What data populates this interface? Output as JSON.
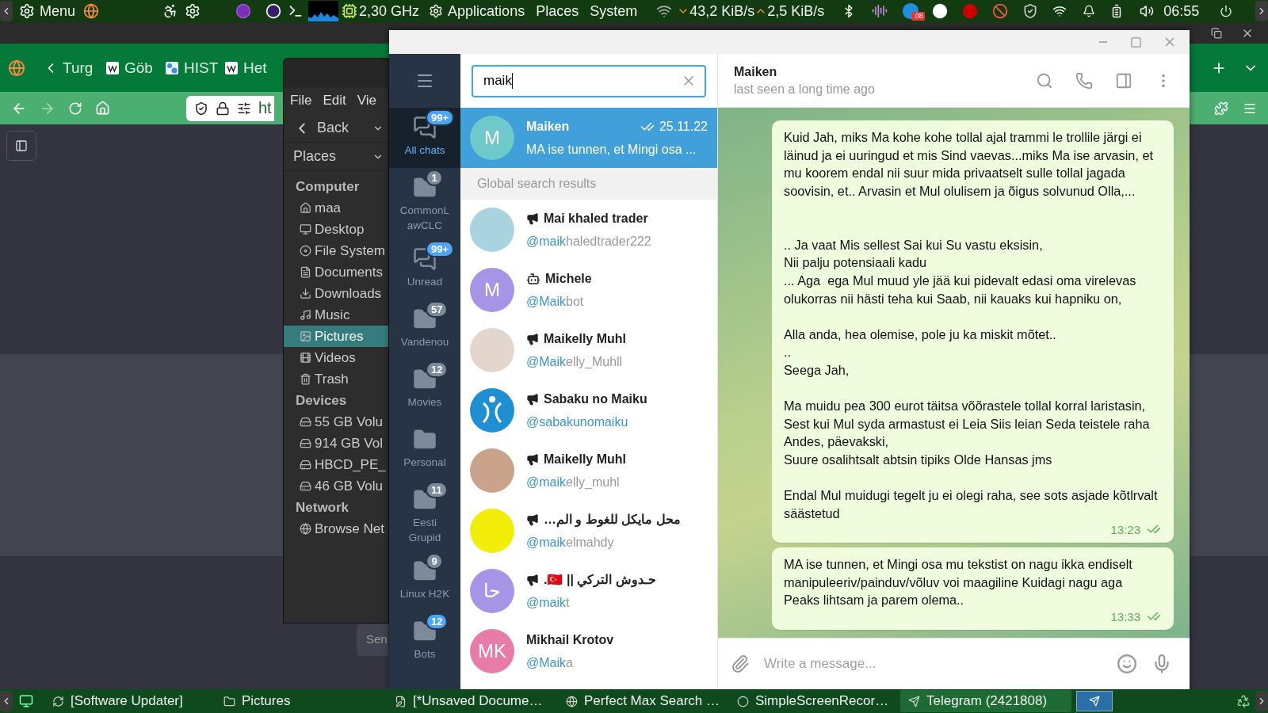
{
  "top_panel": {
    "menu_label": "Menu",
    "cpu_freq": "2,30 GHz",
    "menus": [
      "Applications",
      "Places",
      "System"
    ],
    "net_down": "43,2 KiB/s",
    "net_up": "2,5 KiB/s",
    "tray_badge": ".08",
    "clock": "06:55"
  },
  "browser": {
    "tabs": [
      {
        "label": "Turg",
        "kind": "plain"
      },
      {
        "label": "Göb",
        "kind": "page"
      },
      {
        "label": "HIST",
        "kind": "image"
      },
      {
        "label": "Het",
        "kind": "page"
      }
    ],
    "url": "ht",
    "send_button": "Sen"
  },
  "file_manager": {
    "menus": [
      "File",
      "Edit",
      "Vie"
    ],
    "back": "Back",
    "location": "Places",
    "sections": [
      {
        "title": "Computer",
        "items": [
          {
            "label": "maa",
            "kind": "home",
            "selected": false
          },
          {
            "label": "Desktop",
            "kind": "desktop",
            "selected": false
          },
          {
            "label": "File System",
            "kind": "disk",
            "selected": false
          },
          {
            "label": "Documents",
            "kind": "documents",
            "selected": false
          },
          {
            "label": "Downloads",
            "kind": "downloads",
            "selected": false
          },
          {
            "label": "Music",
            "kind": "music",
            "selected": false
          },
          {
            "label": "Pictures",
            "kind": "pictures",
            "selected": true
          },
          {
            "label": "Videos",
            "kind": "videos",
            "selected": false
          },
          {
            "label": "Trash",
            "kind": "trash",
            "selected": false
          }
        ]
      },
      {
        "title": "Devices",
        "items": [
          {
            "label": "55 GB Volu",
            "kind": "drive",
            "selected": false
          },
          {
            "label": "914 GB Vol",
            "kind": "drive",
            "selected": false
          },
          {
            "label": "HBCD_PE_",
            "kind": "drive",
            "selected": false
          },
          {
            "label": "46 GB Volu",
            "kind": "drive",
            "selected": false
          }
        ]
      },
      {
        "title": "Network",
        "items": [
          {
            "label": "Browse Net",
            "kind": "network",
            "selected": false
          }
        ]
      }
    ]
  },
  "telegram": {
    "folders": [
      {
        "label": "All chats",
        "kind": "chats",
        "badge": "99+",
        "muted": false,
        "selected": true
      },
      {
        "label": "CommonLawCLC",
        "kind": "folder",
        "badge": "1",
        "muted": true,
        "selected": false
      },
      {
        "label": "Unread",
        "kind": "chats",
        "badge": "99+",
        "muted": false,
        "selected": false
      },
      {
        "label": "Vandenou",
        "kind": "folder",
        "badge": "57",
        "muted": true,
        "selected": false
      },
      {
        "label": "Movies",
        "kind": "folder",
        "badge": "12",
        "muted": true,
        "selected": false
      },
      {
        "label": "Personal",
        "kind": "folder",
        "selected": false
      },
      {
        "label": "Eesti Grupid",
        "kind": "folder",
        "badge": "11",
        "muted": true,
        "selected": false
      },
      {
        "label": "Linux H2K",
        "kind": "folder",
        "badge": "9",
        "muted": true,
        "selected": false
      },
      {
        "label": "Bots",
        "kind": "folder",
        "badge": "12",
        "muted": false,
        "selected": false
      }
    ],
    "search": {
      "value": "maik"
    },
    "chats": [
      {
        "name": "Maiken",
        "initials": "M",
        "color": "#6ec9cb",
        "date": "25.11.22",
        "read": true,
        "preview": "MA ise tunnen, et Mingi osa ...",
        "selected": true
      }
    ],
    "section_header": "Global search results",
    "results": [
      {
        "name": "Mai khaled trader",
        "kind": "channel",
        "handle_match": "@maik",
        "handle_rest": "haledtrader222",
        "avatar": {
          "kind": "photo",
          "color": "#a9d3df"
        }
      },
      {
        "name": "Michele",
        "kind": "bot",
        "handle_match": "@Maik",
        "handle_rest": "bot",
        "avatar": {
          "kind": "initials",
          "initials": "M",
          "color": "#a695e7"
        }
      },
      {
        "name": "Maikelly Muhl",
        "kind": "channel",
        "handle_match": "@Maik",
        "handle_rest": "elly_Muhll",
        "avatar": {
          "kind": "photo",
          "color": "#e3d6cc"
        }
      },
      {
        "name": "Sabaku no Maiku",
        "kind": "channel",
        "handle_match": "@sabakunomaiku",
        "avatar": {
          "kind": "logo",
          "color": "#1e90d2"
        }
      },
      {
        "name": "Maikelly Muhl",
        "kind": "channel",
        "handle_match": "@maik",
        "handle_rest": "elly_muhl",
        "avatar": {
          "kind": "photo",
          "color": "#c9a48a"
        }
      },
      {
        "name": "محل مايكل للغوط و الم…",
        "kind": "channel",
        "handle_match": "@maik",
        "handle_rest": "elmahdy",
        "avatar": {
          "kind": "photo",
          "color": "#f2ee0a"
        }
      },
      {
        "name": "حـدوش التركي || 🇹🇷.",
        "kind": "channel",
        "handle_match": "@maik",
        "handle_rest": "t",
        "avatar": {
          "kind": "initials",
          "initials": "حا",
          "color": "#a695e7"
        }
      },
      {
        "name": "Mikhail Krotov",
        "kind": "user",
        "handle_match": "@Maik",
        "handle_rest": "a",
        "avatar": {
          "kind": "initials",
          "initials": "MK",
          "color": "#e87ca8"
        }
      }
    ],
    "chat": {
      "name": "Maiken",
      "status": "last seen a long time ago",
      "messages": [
        {
          "text": "Kuid Jah, miks Ma kohe kohe tollal ajal trammi le trollile järgi ei läinud ja ei uuringud et mis Sind vaevas...miks Ma ise arvasin, et mu koorem endal nii suur mida privaatselt sulle tollal jagada soovisin, et.. Arvasin et Mul olulisem ja õigus solvunud Olla,...\n\n\n.. Ja vaat Mis sellest Sai kui Su vastu eksisin,\nNii palju potensiaali kadu\n... Aga  ega Mul muud yle jää kui pidevalt edasi oma virelevas olukorras nii hästi teha kui Saab, nii kauaks kui hapniku on,\n\nAlla anda, hea olemise, pole ju ka miskit mõtet..\n..\nSeega Jah,\n\nMa muidu pea 300 eurot täitsa võõrastele tollal korral laristasin,\nSest kui Mul syda armastust ei Leia Siis leian Seda teistele raha Andes, päevakski,\nSuure osalihtsalt abtsin tipiks Olde Hansas jms\n\nEndal Mul muidugi tegelt ju ei olegi raha, see sots asjade kõtlrvalt säästetud",
          "time": "13:23",
          "read": true
        },
        {
          "text": "MA ise tunnen, et Mingi osa mu tekstist on nagu ikka endiselt manipuleeriv/painduv/võluv voi maagiline Kuidagi nagu aga Peaks lihtsam ja parem olema..",
          "time": "13:33",
          "read": true
        }
      ],
      "compose_placeholder": "Write a message..."
    }
  },
  "taskbar": {
    "items": [
      {
        "label": "[Software Updater]",
        "kind": "updater",
        "selected": false
      },
      {
        "label": "Pictures",
        "kind": "folder",
        "selected": false
      },
      {
        "label": "[*Unsaved Docume…",
        "kind": "editor",
        "selected": false
      },
      {
        "label": "Perfect Max Search …",
        "kind": "browser",
        "selected": false
      },
      {
        "label": "SimpleScreenRecor…",
        "kind": "recorder",
        "selected": false
      },
      {
        "label": "Telegram (2421808)",
        "kind": "telegram",
        "selected": true
      }
    ]
  }
}
